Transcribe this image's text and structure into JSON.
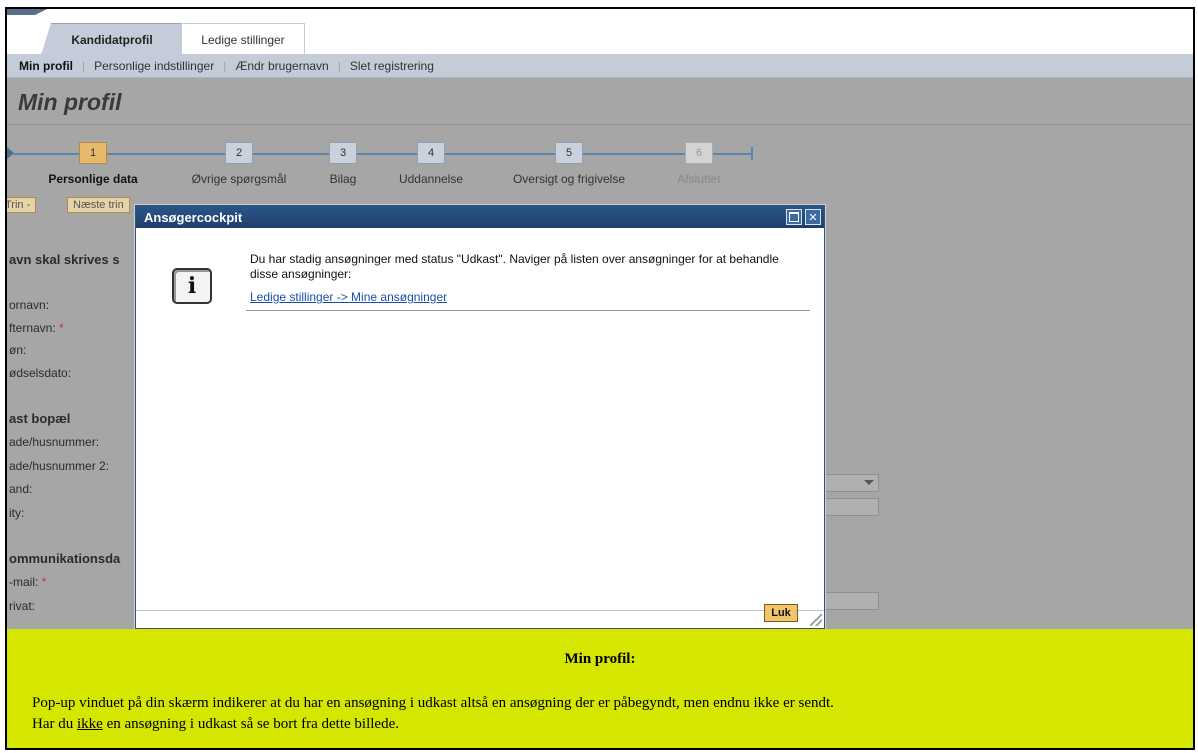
{
  "tabs": [
    {
      "label": "Kandidatprofil",
      "active": true
    },
    {
      "label": "Ledige stillinger",
      "active": false
    }
  ],
  "subnav": [
    {
      "label": "Min profil",
      "active": true
    },
    {
      "label": "Personlige indstillinger"
    },
    {
      "label": "Ændr brugernavn"
    },
    {
      "label": "Slet registrering"
    }
  ],
  "page_title": "Min profil",
  "steps": [
    {
      "num": "1",
      "label": "Personlige data",
      "state": "active"
    },
    {
      "num": "2",
      "label": "Øvrige spørgsmål",
      "state": "normal"
    },
    {
      "num": "3",
      "label": "Bilag",
      "state": "normal"
    },
    {
      "num": "4",
      "label": "Uddannelse",
      "state": "normal"
    },
    {
      "num": "5",
      "label": "Oversigt og frigivelse",
      "state": "normal"
    },
    {
      "num": "6",
      "label": "Afsluttet",
      "state": "disabled"
    }
  ],
  "step_buttons": {
    "prev": "Trin -",
    "next": "Næste trin"
  },
  "form": {
    "section_name": "avn skal skrives s",
    "fornavn": "ornavn:",
    "efternavn": "fternavn:",
    "koen": "øn:",
    "foedselsdato": "ødselsdato:",
    "section_bopael": "ast bopæl",
    "gade1": "ade/husnummer:",
    "gade2": "ade/husnummer 2:",
    "land": "and:",
    "city": "ity:",
    "section_komm": "ommunikationsda",
    "email": "-mail:",
    "privat": "rivat:",
    "required_mark": "*"
  },
  "dialog": {
    "title": "Ansøgercockpit",
    "icon": "info-icon",
    "message": "Du har stadig ansøgninger med status \"Udkast\". Naviger på listen over ansøgninger for at behandle disse ansøgninger:",
    "link": "Ledige stillinger -> Mine ansøgninger",
    "close_button": "Luk",
    "info_glyph": "i"
  },
  "note": {
    "title": "Min profil:",
    "line1": "Pop-up vinduet på din skærm indikerer at du har en ansøgning i udkast altså en ansøgning der er påbegyndt, men endnu ikke er sendt.",
    "line2_pre": "Har du ",
    "line2_underlined": "ikke",
    "line2_post": " en ansøgning i udkast så se bort fra dette billede."
  },
  "colors": {
    "dialog_title_bg": "#22497b",
    "note_bg": "#d5e600",
    "active_step": "#e8b96b",
    "overlay_gray": "#a6a6a6"
  }
}
